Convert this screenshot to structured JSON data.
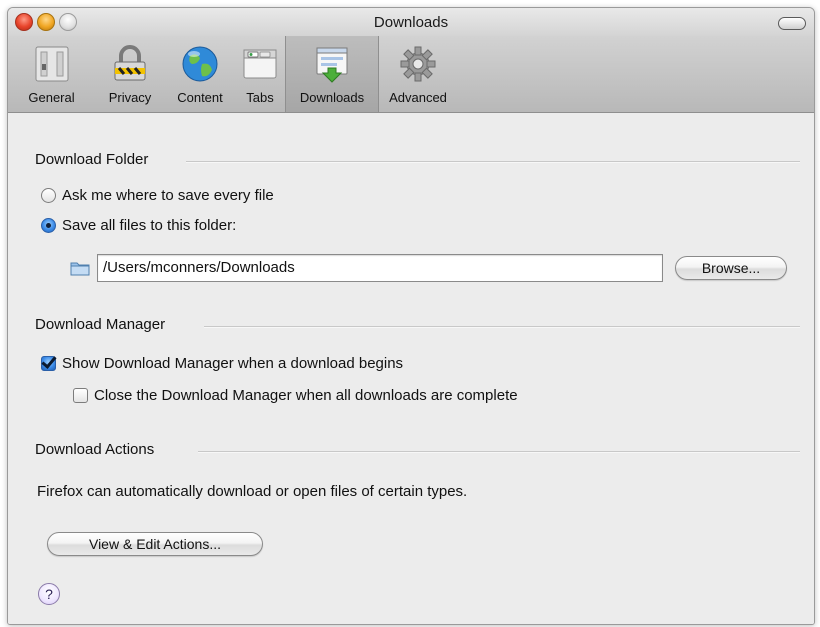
{
  "window": {
    "title": "Downloads"
  },
  "toolbar": {
    "items": [
      {
        "label": "General",
        "icon": "general-switch-icon"
      },
      {
        "label": "Privacy",
        "icon": "privacy-lock-icon"
      },
      {
        "label": "Content",
        "icon": "content-globe-icon"
      },
      {
        "label": "Tabs",
        "icon": "tabs-window-icon"
      },
      {
        "label": "Downloads",
        "icon": "downloads-icon",
        "selected": true
      },
      {
        "label": "Advanced",
        "icon": "advanced-gear-icon"
      }
    ]
  },
  "download_folder": {
    "heading": "Download Folder",
    "ask_label": "Ask me where to save every file",
    "ask_selected": false,
    "save_label": "Save all files to this folder:",
    "save_selected": true,
    "path": "/Users/mconners/Downloads",
    "browse_label": "Browse..."
  },
  "download_manager": {
    "heading": "Download Manager",
    "show_label": "Show Download Manager when a download begins",
    "show_checked": true,
    "close_label": "Close the Download Manager when all downloads are complete",
    "close_checked": false
  },
  "download_actions": {
    "heading": "Download Actions",
    "description": "Firefox can automatically download or open files of certain types.",
    "button_label": "View & Edit Actions..."
  },
  "help": {
    "symbol": "?"
  },
  "colors": {
    "accent_blue": "#3d8ce8",
    "window_bg": "#ececec"
  }
}
